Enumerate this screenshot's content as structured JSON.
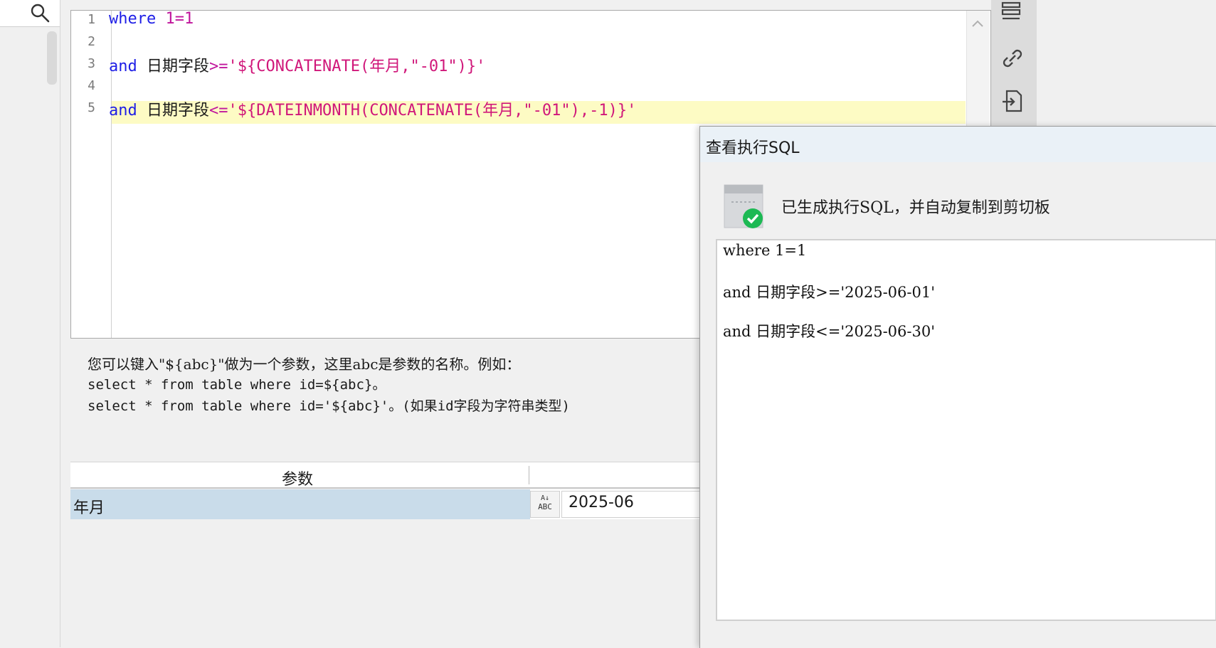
{
  "editor": {
    "line_numbers": [
      "1",
      "2",
      "3",
      "4",
      "5"
    ],
    "lines": [
      {
        "kw": "where",
        "rest_op": "1=1"
      },
      {},
      {
        "kw": "and",
        "name": "日期字段",
        "op": ">=",
        "str": "'${CONCATENATE(年月,\"-01\")}'"
      },
      {},
      {
        "kw": "and",
        "name": "日期字段",
        "op": "<=",
        "str": "'${DATEINMONTH(CONCATENATE(年月,\"-01\"),-1)}'"
      }
    ]
  },
  "help": {
    "line1": "您可以键入\"${abc}\"做为一个参数，这里abc是参数的名称。例如：",
    "line2": "select * from table where id=${abc}。",
    "line3": "select * from table where id='${abc}'。(如果id字段为字符串类型)"
  },
  "params": {
    "header_name": "参数",
    "rows": [
      {
        "name": "年月",
        "type_icon_text": "ABC",
        "value": "2025-06"
      }
    ]
  },
  "dialog": {
    "title": "查看执行SQL",
    "message": "已生成执行SQL，并自动复制到剪切板",
    "sql_lines": [
      "where 1=1",
      "",
      "and 日期字段>='2025-06-01'",
      "",
      "and 日期字段<='2025-06-30'"
    ]
  },
  "colors": {
    "keyword": "#1e1ee6",
    "operator": "#c0169c",
    "string": "#d0177a",
    "current_line": "#fdfbc4",
    "selected_row": "#c9dcea",
    "success": "#1db954"
  },
  "icons": [
    "search-icon",
    "list-icon",
    "link-icon",
    "import-icon",
    "sql-success-icon",
    "chevron-up-icon"
  ]
}
